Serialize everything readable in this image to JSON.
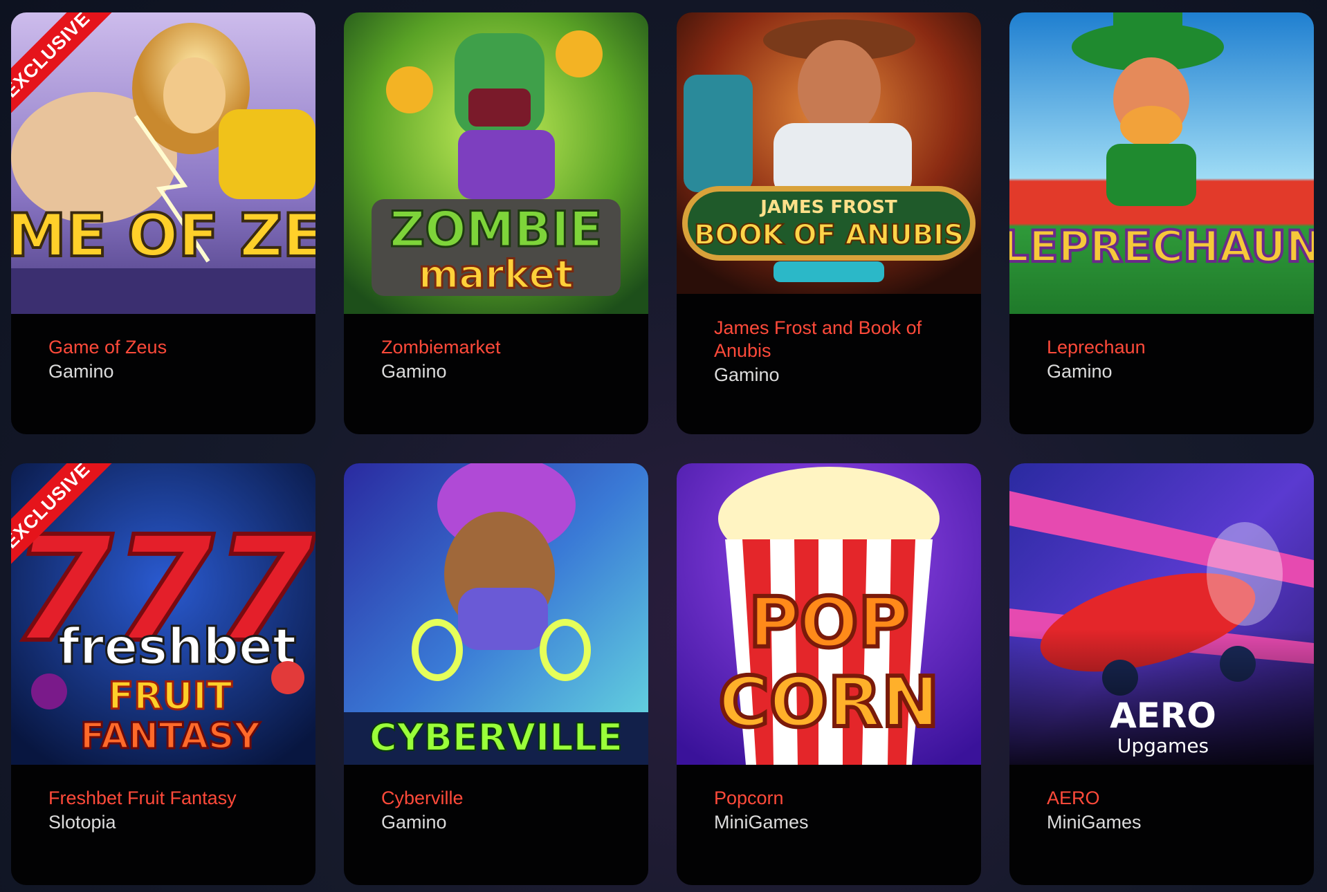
{
  "games": [
    {
      "title": "Game of Zeus",
      "provider": "Gamino",
      "ribbon": "EXCLUSIVE",
      "art_text": "GAME OF ZEUS",
      "colors": {
        "accent": "#ff4a3a",
        "bg1": "#6b5aa8",
        "bg2": "#c8b7e6"
      }
    },
    {
      "title": "Zombiemarket",
      "provider": "Gamino",
      "art_text_1": "ZOMBIE",
      "art_text_2": "market",
      "colors": {
        "accent": "#ff4a3a",
        "bg1": "#1c6b1f",
        "bg2": "#8fd63a"
      }
    },
    {
      "title": "James Frost and Book of Anubis",
      "provider": "Gamino",
      "art_text_1": "JAMES FROST",
      "art_text_2": "BOOK OF ANUBIS",
      "colors": {
        "accent": "#ff4a3a",
        "bg1": "#3a1a0e",
        "bg2": "#c25a1c"
      }
    },
    {
      "title": "Leprechaun",
      "provider": "Gamino",
      "art_text": "LEPRECHAUN",
      "colors": {
        "accent": "#ff4a3a",
        "bg1": "#2f8ed6",
        "bg2": "#8ad0f0"
      }
    },
    {
      "title": "Freshbet Fruit Fantasy",
      "provider": "Slotopia",
      "ribbon": "EXCLUSIVE",
      "art_text_1": "777",
      "art_text_2": "freshbet",
      "art_text_3": "FRUIT",
      "art_text_4": "FANTASY",
      "colors": {
        "accent": "#ff4a3a",
        "bg1": "#0a1a4a",
        "bg2": "#1a3ea0"
      }
    },
    {
      "title": "Cyberville",
      "provider": "Gamino",
      "art_text": "CYBERVILLE",
      "colors": {
        "accent": "#ff4a3a",
        "bg1": "#1a2a7a",
        "bg2": "#3bb5d6"
      }
    },
    {
      "title": "Popcorn",
      "provider": "MiniGames",
      "art_text_1": "POP",
      "art_text_2": "CORN",
      "colors": {
        "accent": "#ff4a3a",
        "bg1": "#4a1a9a",
        "bg2": "#8a3ae0"
      }
    },
    {
      "title": "AERO",
      "provider": "MiniGames",
      "art_text_1": "AERO",
      "art_text_2": "Upgames",
      "colors": {
        "accent": "#ff4a3a",
        "bg1": "#3a2a9a",
        "bg2": "#e04aa0"
      }
    }
  ]
}
